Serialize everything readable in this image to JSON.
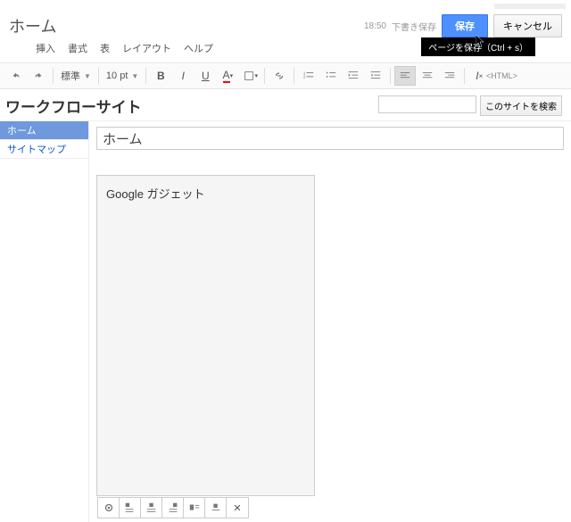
{
  "user_pixelated": true,
  "header": {
    "page_title": "ホーム",
    "timestamp": "18:50",
    "draft_label": "下書き保存",
    "save_label": "保存",
    "cancel_label": "キャンセル",
    "tooltip": "ページを保存（Ctrl + s）"
  },
  "menus": {
    "insert": "挿入",
    "format": "書式",
    "table": "表",
    "layout": "レイアウト",
    "help": "ヘルプ"
  },
  "toolbar": {
    "font_preset": "標準",
    "font_size": "10 pt",
    "html_label": "<HTML>"
  },
  "site": {
    "title": "ワークフローサイト",
    "search_button": "このサイトを検索"
  },
  "sidebar": {
    "items": [
      {
        "label": "ホーム",
        "active": true
      },
      {
        "label": "サイトマップ",
        "active": false
      }
    ]
  },
  "content": {
    "title_value": "ホーム",
    "gadget_label": "Google ガジェット"
  }
}
